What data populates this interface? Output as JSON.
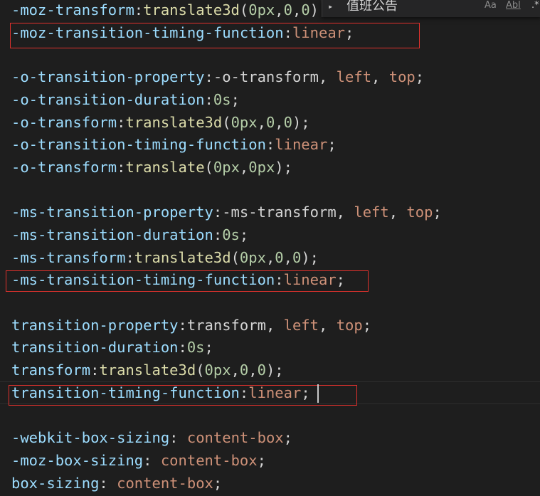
{
  "find_widget": {
    "query": "值班公告",
    "match_case_label": "Aa",
    "whole_word_label": "Abl",
    "regex_label": ".*"
  },
  "lines": [
    {
      "prop": "-moz-transform",
      "val_parts": [
        [
          "fn",
          "translate3d"
        ],
        [
          "punc",
          "("
        ],
        [
          "num",
          "0px"
        ],
        [
          "punc",
          ","
        ],
        [
          "num",
          "0"
        ],
        [
          "punc",
          ","
        ],
        [
          "num",
          "0"
        ],
        [
          "punc",
          ");"
        ]
      ]
    },
    {
      "prop": "-moz-transition-timing-function",
      "val_parts": [
        [
          "val",
          "linear"
        ],
        [
          "punc",
          ";"
        ]
      ]
    },
    {
      "prop": "-o-transition-property",
      "val_parts": [
        [
          "punc",
          "-o-transform"
        ],
        [
          "punc",
          ", "
        ],
        [
          "val",
          "left"
        ],
        [
          "punc",
          ", "
        ],
        [
          "val",
          "top"
        ],
        [
          "punc",
          ";"
        ]
      ]
    },
    {
      "prop": "-o-transition-duration",
      "val_parts": [
        [
          "num",
          "0s"
        ],
        [
          "punc",
          ";"
        ]
      ]
    },
    {
      "prop": "-o-transform",
      "val_parts": [
        [
          "fn",
          "translate3d"
        ],
        [
          "punc",
          "("
        ],
        [
          "num",
          "0px"
        ],
        [
          "punc",
          ","
        ],
        [
          "num",
          "0"
        ],
        [
          "punc",
          ","
        ],
        [
          "num",
          "0"
        ],
        [
          "punc",
          ");"
        ]
      ]
    },
    {
      "prop": "-o-transition-timing-function",
      "val_parts": [
        [
          "val",
          "linear"
        ],
        [
          "punc",
          ";"
        ]
      ]
    },
    {
      "prop": "-o-transform",
      "val_parts": [
        [
          "fn",
          "translate"
        ],
        [
          "punc",
          "("
        ],
        [
          "num",
          "0px"
        ],
        [
          "punc",
          ","
        ],
        [
          "num",
          "0px"
        ],
        [
          "punc",
          ");"
        ]
      ]
    },
    {
      "prop": "-ms-transition-property",
      "val_parts": [
        [
          "punc",
          "-ms-transform"
        ],
        [
          "punc",
          ", "
        ],
        [
          "val",
          "left"
        ],
        [
          "punc",
          ", "
        ],
        [
          "val",
          "top"
        ],
        [
          "punc",
          ";"
        ]
      ]
    },
    {
      "prop": "-ms-transition-duration",
      "val_parts": [
        [
          "num",
          "0s"
        ],
        [
          "punc",
          ";"
        ]
      ]
    },
    {
      "prop": "-ms-transform",
      "val_parts": [
        [
          "fn",
          "translate3d"
        ],
        [
          "punc",
          "("
        ],
        [
          "num",
          "0px"
        ],
        [
          "punc",
          ","
        ],
        [
          "num",
          "0"
        ],
        [
          "punc",
          ","
        ],
        [
          "num",
          "0"
        ],
        [
          "punc",
          ");"
        ]
      ]
    },
    {
      "prop": "-ms-transition-timing-function",
      "val_parts": [
        [
          "val",
          "linear"
        ],
        [
          "punc",
          ";"
        ]
      ]
    },
    {
      "prop": "transition-property",
      "val_parts": [
        [
          "punc",
          "transform"
        ],
        [
          "punc",
          ", "
        ],
        [
          "val",
          "left"
        ],
        [
          "punc",
          ", "
        ],
        [
          "val",
          "top"
        ],
        [
          "punc",
          ";"
        ]
      ]
    },
    {
      "prop": "transition-duration",
      "val_parts": [
        [
          "num",
          "0s"
        ],
        [
          "punc",
          ";"
        ]
      ]
    },
    {
      "prop": "transform",
      "val_parts": [
        [
          "fn",
          "translate3d"
        ],
        [
          "punc",
          "("
        ],
        [
          "num",
          "0px"
        ],
        [
          "punc",
          ","
        ],
        [
          "num",
          "0"
        ],
        [
          "punc",
          ","
        ],
        [
          "num",
          "0"
        ],
        [
          "punc",
          ");"
        ]
      ]
    },
    {
      "prop": "transition-timing-function",
      "val_parts": [
        [
          "val",
          "linear"
        ],
        [
          "punc",
          ";"
        ]
      ]
    },
    {
      "prop": "-webkit-box-sizing",
      "val_parts": [
        [
          "punc",
          " "
        ],
        [
          "val",
          "content-box"
        ],
        [
          "punc",
          ";"
        ]
      ]
    },
    {
      "prop": "-moz-box-sizing",
      "val_parts": [
        [
          "punc",
          " "
        ],
        [
          "val",
          "content-box"
        ],
        [
          "punc",
          ";"
        ]
      ]
    },
    {
      "prop": "box-sizing",
      "val_parts": [
        [
          "punc",
          " "
        ],
        [
          "val",
          "content-box"
        ],
        [
          "punc",
          ";"
        ]
      ]
    }
  ],
  "colors": {
    "background": "#1e1e1e",
    "property": "#9cdcfe",
    "value": "#ce9178",
    "number": "#b5cea8",
    "function": "#dcdcaa",
    "highlight_box": "#e0312d"
  }
}
